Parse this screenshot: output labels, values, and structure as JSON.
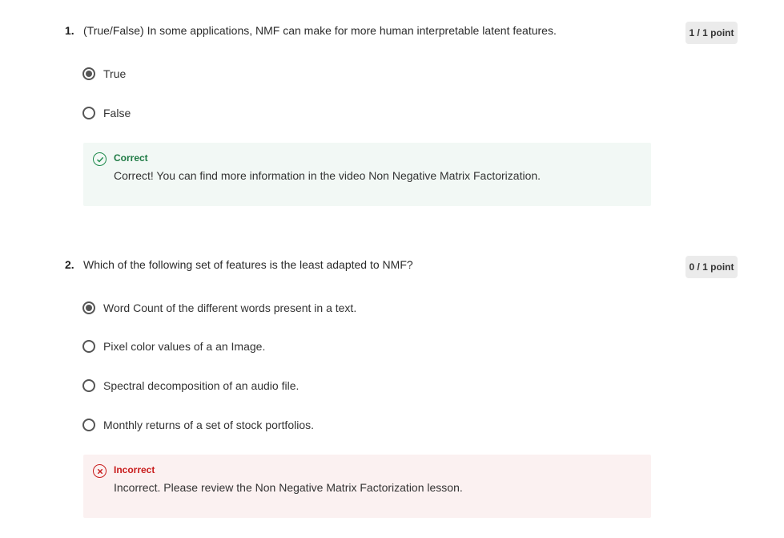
{
  "questions": [
    {
      "number": "1.",
      "text": "(True/False) In some applications, NMF can make for more human interpretable latent features.",
      "points": "1 / 1 point",
      "options": [
        {
          "label": "True",
          "selected": true
        },
        {
          "label": "False",
          "selected": false
        }
      ],
      "feedback": {
        "status": "Correct",
        "message": "Correct! You can find more information in the video Non Negative Matrix Factorization.",
        "icon": "check-circle-icon",
        "color": "#1e7a44",
        "background": "#f2f8f5"
      }
    },
    {
      "number": "2.",
      "text": "Which of the following set of features is the least adapted to NMF?",
      "points": "0 / 1 point",
      "options": [
        {
          "label": "Word Count of the different words present in a text.",
          "selected": true
        },
        {
          "label": "Pixel color values of a an Image.",
          "selected": false
        },
        {
          "label": "Spectral decomposition of an audio file.",
          "selected": false
        },
        {
          "label": "Monthly returns of a set of stock portfolios.",
          "selected": false
        }
      ],
      "feedback": {
        "status": "Incorrect",
        "message": "Incorrect. Please review the Non Negative Matrix Factorization lesson.",
        "icon": "x-circle-icon",
        "color": "#c81c1c",
        "background": "#fbf1f1"
      }
    }
  ]
}
